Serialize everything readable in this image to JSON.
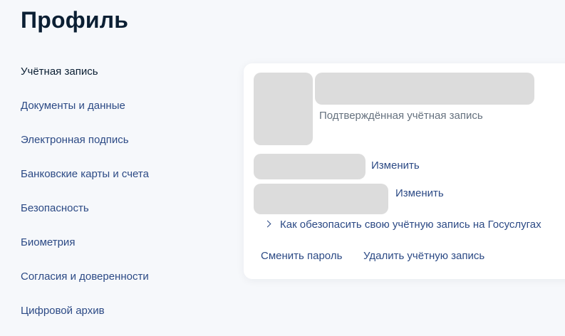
{
  "page": {
    "title": "Профиль"
  },
  "sidebar": {
    "items": [
      {
        "label": "Учётная запись"
      },
      {
        "label": "Документы и данные"
      },
      {
        "label": "Электронная подпись"
      },
      {
        "label": "Банковские карты и счета"
      },
      {
        "label": "Безопасность"
      },
      {
        "label": "Биометрия"
      },
      {
        "label": "Согласия и доверенности"
      },
      {
        "label": "Цифровой архив"
      }
    ]
  },
  "account_card": {
    "verified_status": "Подтверждённая учётная запись",
    "phone_edit_label": "Изменить",
    "email_edit_label": "Изменить",
    "security_tip": "Как обезопасить свою учётную запись на Госуслугах",
    "change_password_label": "Сменить пароль",
    "delete_account_label": "Удалить учётную запись"
  },
  "colors": {
    "title": "#0b1f33",
    "link": "#2c4a85",
    "muted": "#66727f",
    "placeholder": "#dcdcdc",
    "background": "#f6f8fb",
    "card": "#ffffff"
  },
  "icons": {
    "tip_toggle": "chevron-right-icon"
  }
}
